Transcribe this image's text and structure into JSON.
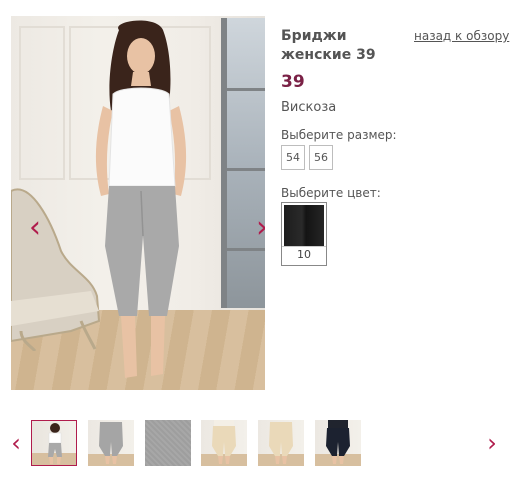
{
  "product": {
    "title": "Бриджи женские 39",
    "back_link": "назад к обзору",
    "price": "39",
    "material": "Вискоза",
    "size_label": "Выберите размер:",
    "sizes": [
      "54",
      "56"
    ],
    "color_label": "Выберите цвет:",
    "color_option": {
      "label": "10",
      "swatch_color": "#1f1f1f"
    }
  },
  "gallery": {
    "prev_label": "‹",
    "next_label": "›",
    "thumb_prev_label": "‹",
    "thumb_next_label": "›",
    "thumbnails": [
      {
        "pants_color": "#a9a9a9",
        "top_color": "#ffffff",
        "active": true
      },
      {
        "pants_color": "#a5a5a5",
        "top_color": "none",
        "active": false
      },
      {
        "pants_color": "#9e9e9e",
        "top_color": "none",
        "active": false
      },
      {
        "pants_color": "#ead9b9",
        "top_color": "#f4efe6",
        "active": false
      },
      {
        "pants_color": "#ead9b9",
        "top_color": "none",
        "active": false
      },
      {
        "pants_color": "#1c2230",
        "top_color": "#20242e",
        "active": false
      }
    ]
  },
  "colors": {
    "accent": "#b01c4c",
    "price": "#7a2146",
    "text": "#555555"
  }
}
